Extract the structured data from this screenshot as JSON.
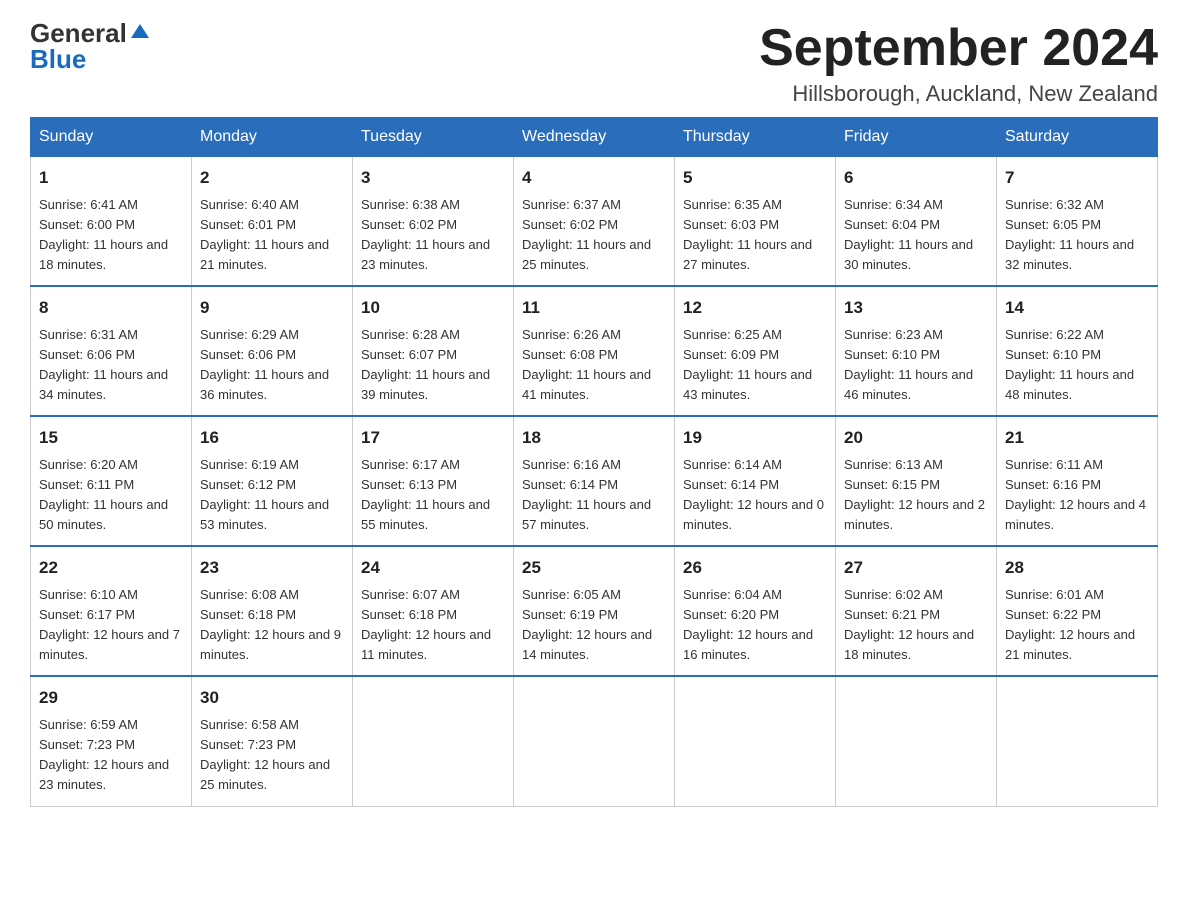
{
  "logo": {
    "general": "General",
    "blue": "Blue"
  },
  "title": "September 2024",
  "subtitle": "Hillsborough, Auckland, New Zealand",
  "days_of_week": [
    "Sunday",
    "Monday",
    "Tuesday",
    "Wednesday",
    "Thursday",
    "Friday",
    "Saturday"
  ],
  "weeks": [
    [
      {
        "day": "1",
        "sunrise": "6:41 AM",
        "sunset": "6:00 PM",
        "daylight": "11 hours and 18 minutes."
      },
      {
        "day": "2",
        "sunrise": "6:40 AM",
        "sunset": "6:01 PM",
        "daylight": "11 hours and 21 minutes."
      },
      {
        "day": "3",
        "sunrise": "6:38 AM",
        "sunset": "6:02 PM",
        "daylight": "11 hours and 23 minutes."
      },
      {
        "day": "4",
        "sunrise": "6:37 AM",
        "sunset": "6:02 PM",
        "daylight": "11 hours and 25 minutes."
      },
      {
        "day": "5",
        "sunrise": "6:35 AM",
        "sunset": "6:03 PM",
        "daylight": "11 hours and 27 minutes."
      },
      {
        "day": "6",
        "sunrise": "6:34 AM",
        "sunset": "6:04 PM",
        "daylight": "11 hours and 30 minutes."
      },
      {
        "day": "7",
        "sunrise": "6:32 AM",
        "sunset": "6:05 PM",
        "daylight": "11 hours and 32 minutes."
      }
    ],
    [
      {
        "day": "8",
        "sunrise": "6:31 AM",
        "sunset": "6:06 PM",
        "daylight": "11 hours and 34 minutes."
      },
      {
        "day": "9",
        "sunrise": "6:29 AM",
        "sunset": "6:06 PM",
        "daylight": "11 hours and 36 minutes."
      },
      {
        "day": "10",
        "sunrise": "6:28 AM",
        "sunset": "6:07 PM",
        "daylight": "11 hours and 39 minutes."
      },
      {
        "day": "11",
        "sunrise": "6:26 AM",
        "sunset": "6:08 PM",
        "daylight": "11 hours and 41 minutes."
      },
      {
        "day": "12",
        "sunrise": "6:25 AM",
        "sunset": "6:09 PM",
        "daylight": "11 hours and 43 minutes."
      },
      {
        "day": "13",
        "sunrise": "6:23 AM",
        "sunset": "6:10 PM",
        "daylight": "11 hours and 46 minutes."
      },
      {
        "day": "14",
        "sunrise": "6:22 AM",
        "sunset": "6:10 PM",
        "daylight": "11 hours and 48 minutes."
      }
    ],
    [
      {
        "day": "15",
        "sunrise": "6:20 AM",
        "sunset": "6:11 PM",
        "daylight": "11 hours and 50 minutes."
      },
      {
        "day": "16",
        "sunrise": "6:19 AM",
        "sunset": "6:12 PM",
        "daylight": "11 hours and 53 minutes."
      },
      {
        "day": "17",
        "sunrise": "6:17 AM",
        "sunset": "6:13 PM",
        "daylight": "11 hours and 55 minutes."
      },
      {
        "day": "18",
        "sunrise": "6:16 AM",
        "sunset": "6:14 PM",
        "daylight": "11 hours and 57 minutes."
      },
      {
        "day": "19",
        "sunrise": "6:14 AM",
        "sunset": "6:14 PM",
        "daylight": "12 hours and 0 minutes."
      },
      {
        "day": "20",
        "sunrise": "6:13 AM",
        "sunset": "6:15 PM",
        "daylight": "12 hours and 2 minutes."
      },
      {
        "day": "21",
        "sunrise": "6:11 AM",
        "sunset": "6:16 PM",
        "daylight": "12 hours and 4 minutes."
      }
    ],
    [
      {
        "day": "22",
        "sunrise": "6:10 AM",
        "sunset": "6:17 PM",
        "daylight": "12 hours and 7 minutes."
      },
      {
        "day": "23",
        "sunrise": "6:08 AM",
        "sunset": "6:18 PM",
        "daylight": "12 hours and 9 minutes."
      },
      {
        "day": "24",
        "sunrise": "6:07 AM",
        "sunset": "6:18 PM",
        "daylight": "12 hours and 11 minutes."
      },
      {
        "day": "25",
        "sunrise": "6:05 AM",
        "sunset": "6:19 PM",
        "daylight": "12 hours and 14 minutes."
      },
      {
        "day": "26",
        "sunrise": "6:04 AM",
        "sunset": "6:20 PM",
        "daylight": "12 hours and 16 minutes."
      },
      {
        "day": "27",
        "sunrise": "6:02 AM",
        "sunset": "6:21 PM",
        "daylight": "12 hours and 18 minutes."
      },
      {
        "day": "28",
        "sunrise": "6:01 AM",
        "sunset": "6:22 PM",
        "daylight": "12 hours and 21 minutes."
      }
    ],
    [
      {
        "day": "29",
        "sunrise": "6:59 AM",
        "sunset": "7:23 PM",
        "daylight": "12 hours and 23 minutes."
      },
      {
        "day": "30",
        "sunrise": "6:58 AM",
        "sunset": "7:23 PM",
        "daylight": "12 hours and 25 minutes."
      },
      null,
      null,
      null,
      null,
      null
    ]
  ]
}
